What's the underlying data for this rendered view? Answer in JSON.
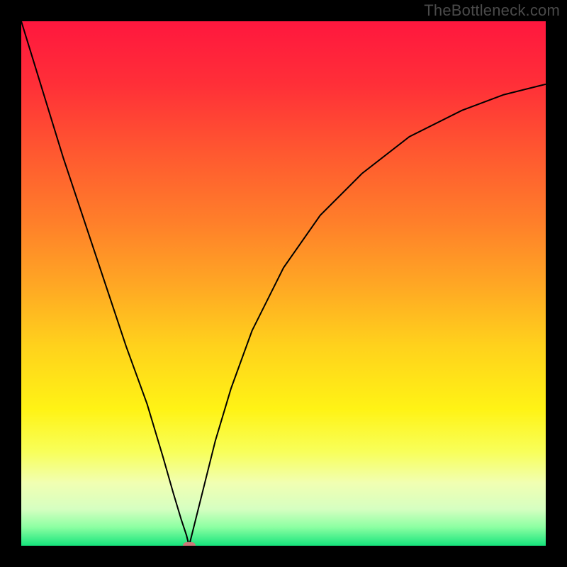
{
  "watermark": "TheBottleneck.com",
  "colors": {
    "frame": "#000000",
    "curve": "#000000",
    "marker": "#cb7a79",
    "gradient_stops": [
      {
        "offset": 0.0,
        "color": "#ff173e"
      },
      {
        "offset": 0.12,
        "color": "#ff2f38"
      },
      {
        "offset": 0.25,
        "color": "#ff5830"
      },
      {
        "offset": 0.38,
        "color": "#ff7e2a"
      },
      {
        "offset": 0.5,
        "color": "#ffa624"
      },
      {
        "offset": 0.62,
        "color": "#ffd21c"
      },
      {
        "offset": 0.74,
        "color": "#fff315"
      },
      {
        "offset": 0.82,
        "color": "#f8ff59"
      },
      {
        "offset": 0.88,
        "color": "#f1ffb2"
      },
      {
        "offset": 0.93,
        "color": "#d6ffc1"
      },
      {
        "offset": 0.965,
        "color": "#8bffa2"
      },
      {
        "offset": 1.0,
        "color": "#16e47c"
      }
    ]
  },
  "chart_data": {
    "type": "line",
    "title": "",
    "xlabel": "",
    "ylabel": "",
    "xlim": [
      0,
      100
    ],
    "ylim": [
      0,
      100
    ],
    "marker": {
      "x": 32,
      "y": 0
    },
    "series": [
      {
        "name": "curve",
        "x": [
          0,
          4,
          8,
          12,
          16,
          20,
          24,
          27,
          29,
          30.5,
          31.5,
          32,
          32.5,
          33.5,
          35,
          37,
          40,
          44,
          50,
          57,
          65,
          74,
          84,
          92,
          100
        ],
        "y": [
          100,
          87,
          74,
          62,
          50,
          38,
          27,
          17,
          10,
          5,
          2,
          0,
          2,
          6,
          12,
          20,
          30,
          41,
          53,
          63,
          71,
          78,
          83,
          86,
          88
        ]
      }
    ]
  }
}
